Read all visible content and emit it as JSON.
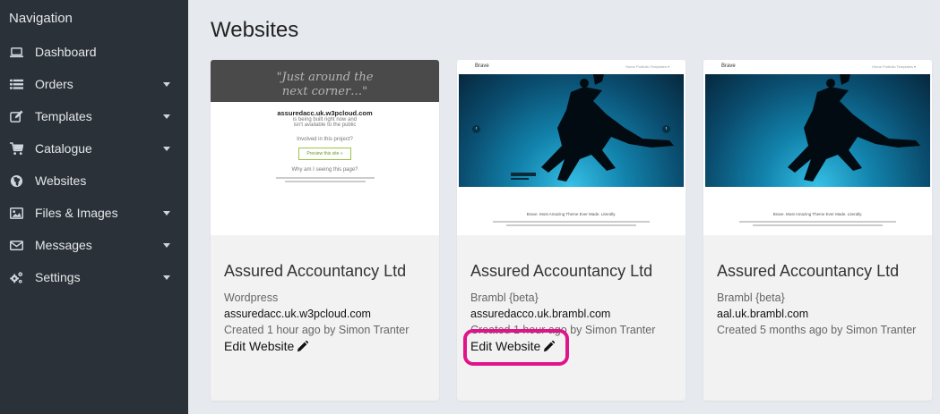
{
  "sidebar": {
    "heading": "Navigation",
    "items": [
      {
        "label": "Dashboard",
        "icon": "laptop-icon",
        "has_submenu": false
      },
      {
        "label": "Orders",
        "icon": "list-icon",
        "has_submenu": true
      },
      {
        "label": "Templates",
        "icon": "edit-icon",
        "has_submenu": true
      },
      {
        "label": "Catalogue",
        "icon": "cart-icon",
        "has_submenu": true
      },
      {
        "label": "Websites",
        "icon": "globe-icon",
        "has_submenu": false
      },
      {
        "label": "Files & Images",
        "icon": "image-icon",
        "has_submenu": true
      },
      {
        "label": "Messages",
        "icon": "envelope-icon",
        "has_submenu": true
      },
      {
        "label": "Settings",
        "icon": "cogs-icon",
        "has_submenu": true
      }
    ]
  },
  "main": {
    "title": "Websites",
    "cards": [
      {
        "name": "Assured Accountancy Ltd",
        "platform": "Wordpress",
        "domain": "assuredacc.uk.w3pcloud.com",
        "created": "Created 1 hour ago by Simon Tranter",
        "edit_label": "Edit Website",
        "preview": {
          "quote": "\"Just around the next corner…\"",
          "domain": "assuredacc.uk.w3pcloud.com",
          "line1": "is being built right now and",
          "line2": "isn't available to the public",
          "involved": "Involved in this project?",
          "button": "Preview this site »",
          "why": "Why am I seeing this page?"
        }
      },
      {
        "name": "Assured Accountancy Ltd",
        "platform": "Brambl {beta}",
        "domain": "assuredacco.uk.brambl.com",
        "created": "Created 1 hour ago by Simon Tranter",
        "edit_label": "Edit Website",
        "preview": {
          "logo": "Brave",
          "nav": "Home   Portfolio   Templates ▾",
          "tagline": "Brave. Most Amazing Theme Ever Made. Literally."
        }
      },
      {
        "name": "Assured Accountancy Ltd",
        "platform": "Brambl {beta}",
        "domain": "aal.uk.brambl.com",
        "created": "Created 5 months ago by Simon Tranter",
        "edit_label": "",
        "preview": {
          "logo": "Brave",
          "nav": "Home   Portfolio   Templates ▾",
          "tagline": "Brave. Most Amazing Theme Ever Made. Literally."
        }
      }
    ]
  },
  "colors": {
    "sidebar_bg": "#2b3138",
    "main_bg": "#e6e9ee",
    "card_bg": "#f2f2f2",
    "highlight": "#e0148a"
  }
}
